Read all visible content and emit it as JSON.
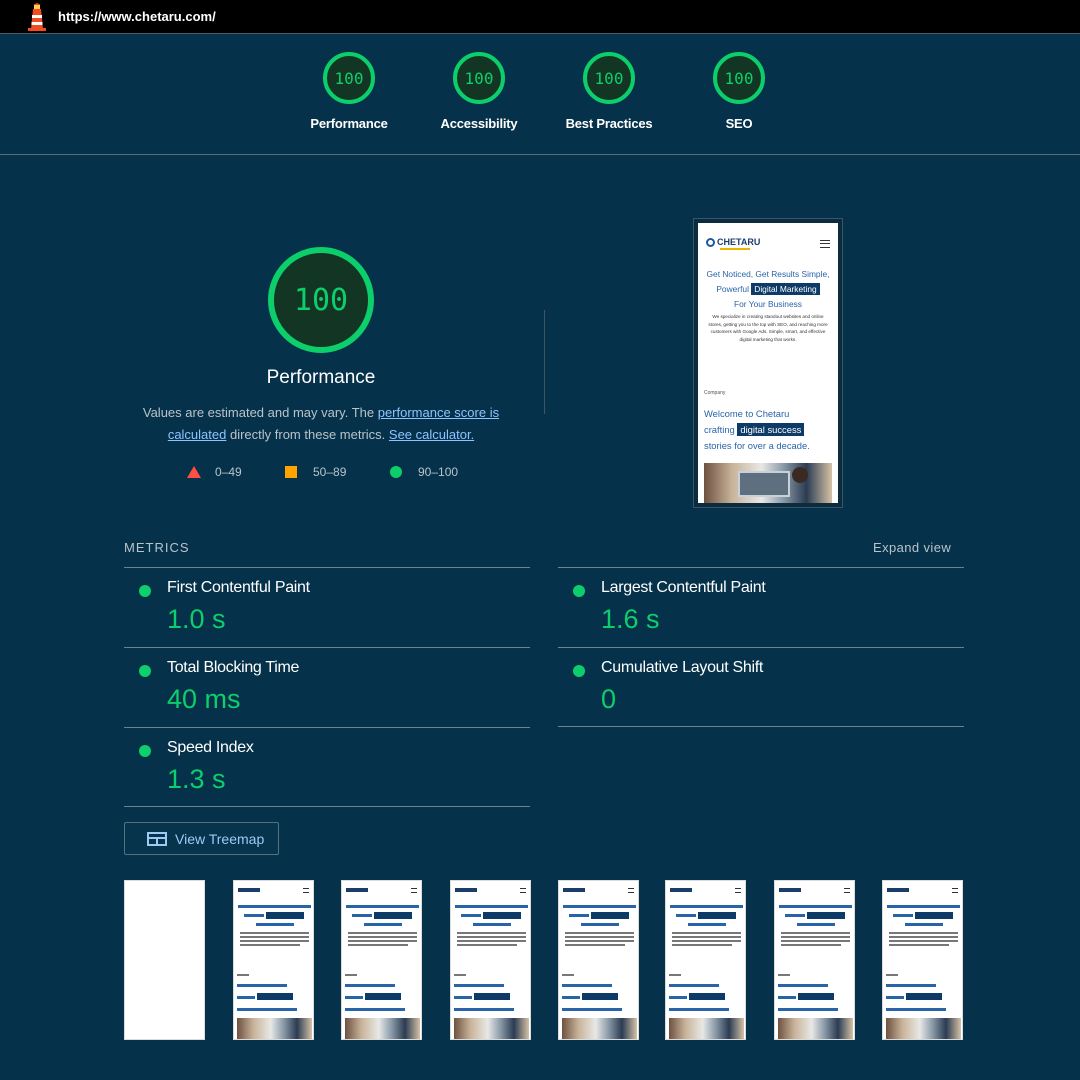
{
  "url": "https://www.chetaru.com/",
  "categories": [
    {
      "label": "Performance",
      "score": "100"
    },
    {
      "label": "Accessibility",
      "score": "100"
    },
    {
      "label": "Best Practices",
      "score": "100"
    },
    {
      "label": "SEO",
      "score": "100"
    }
  ],
  "main": {
    "score": "100",
    "title": "Performance",
    "desc_prefix": "Values are estimated and may vary. The ",
    "desc_link1": "performance score is calculated",
    "desc_middle": " directly from these metrics. ",
    "desc_link2": "See calculator."
  },
  "legend": [
    {
      "label": "0–49",
      "color": "#ff4e42",
      "shape": "triangle"
    },
    {
      "label": "50–89",
      "color": "#ffa400",
      "shape": "square"
    },
    {
      "label": "90–100",
      "color": "#0cce6b",
      "shape": "circle"
    }
  ],
  "screenshot": {
    "logo": "CHETARU",
    "headline_1": "Get Noticed, Get Results Simple,",
    "headline_2": "Powerful",
    "headline_hl": "Digital Marketing",
    "headline_3": "For Your Business",
    "paragraph": "We specialize in creating standout websites and online stores, getting you to the top with SEO, and reaching more customers with Google Ads. Simple, smart, and effective digital marketing that works.",
    "section_label": "Company",
    "h2_1": "Welcome to Chetaru",
    "h2_2": "crafting",
    "h2_hl": "digital  success",
    "h2_3": "stories for over a decade."
  },
  "metrics": {
    "heading": "METRICS",
    "expand_label": "Expand view",
    "items": [
      {
        "name": "First Contentful Paint",
        "value": "1.0 s"
      },
      {
        "name": "Largest Contentful Paint",
        "value": "1.6 s"
      },
      {
        "name": "Total Blocking Time",
        "value": "40 ms"
      },
      {
        "name": "Cumulative Layout Shift",
        "value": "0"
      },
      {
        "name": "Speed Index",
        "value": "1.3 s"
      }
    ]
  },
  "treemap_label": "View Treemap",
  "colors": {
    "background": "#05324a",
    "pass": "#0cce6b",
    "average": "#ffa400",
    "fail": "#ff4e42",
    "link": "#8fc3ff"
  }
}
